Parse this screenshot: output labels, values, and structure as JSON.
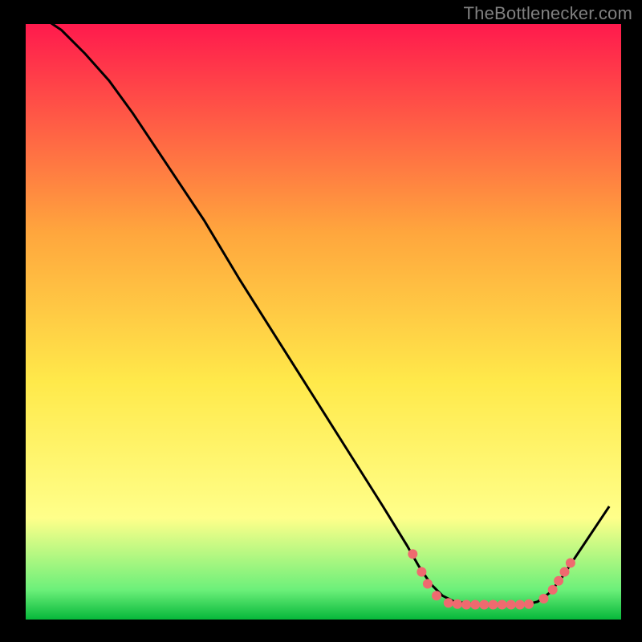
{
  "attribution": "TheBottlenecker.com",
  "colors": {
    "frame": "#000000",
    "watermark": "#808080",
    "grad_top": "#ff1a4d",
    "grad_mid_high": "#ffa63d",
    "grad_mid": "#ffe94a",
    "grad_low_yellow": "#ffff8a",
    "grad_low_green": "#6cf07a",
    "grad_bottom": "#06b83a",
    "line": "#000000",
    "dot": "#ef6a6f"
  },
  "chart_data": {
    "type": "line",
    "title": "",
    "xlabel": "",
    "ylabel": "",
    "xlim": [
      0,
      100
    ],
    "ylim": [
      0,
      100
    ],
    "curve": [
      {
        "x": 3.0,
        "y": 101.0
      },
      {
        "x": 6.0,
        "y": 99.0
      },
      {
        "x": 10.0,
        "y": 95.0
      },
      {
        "x": 14.0,
        "y": 90.5
      },
      {
        "x": 18.0,
        "y": 85.0
      },
      {
        "x": 24.0,
        "y": 76.0
      },
      {
        "x": 30.0,
        "y": 67.0
      },
      {
        "x": 36.0,
        "y": 57.0
      },
      {
        "x": 42.0,
        "y": 47.5
      },
      {
        "x": 48.0,
        "y": 38.0
      },
      {
        "x": 54.0,
        "y": 28.5
      },
      {
        "x": 60.0,
        "y": 19.0
      },
      {
        "x": 64.0,
        "y": 12.5
      },
      {
        "x": 66.0,
        "y": 9.0
      },
      {
        "x": 68.0,
        "y": 6.0
      },
      {
        "x": 70.0,
        "y": 4.0
      },
      {
        "x": 72.0,
        "y": 3.0
      },
      {
        "x": 76.0,
        "y": 2.5
      },
      {
        "x": 80.0,
        "y": 2.5
      },
      {
        "x": 84.0,
        "y": 2.5
      },
      {
        "x": 86.0,
        "y": 3.0
      },
      {
        "x": 88.0,
        "y": 4.5
      },
      {
        "x": 90.0,
        "y": 7.0
      },
      {
        "x": 92.0,
        "y": 10.0
      },
      {
        "x": 94.0,
        "y": 13.0
      },
      {
        "x": 96.0,
        "y": 16.0
      },
      {
        "x": 98.0,
        "y": 19.0
      }
    ],
    "dots": [
      {
        "x": 65.0,
        "y": 11.0
      },
      {
        "x": 66.5,
        "y": 8.0
      },
      {
        "x": 67.5,
        "y": 6.0
      },
      {
        "x": 69.0,
        "y": 4.0
      },
      {
        "x": 71.0,
        "y": 2.8
      },
      {
        "x": 72.5,
        "y": 2.6
      },
      {
        "x": 74.0,
        "y": 2.5
      },
      {
        "x": 75.5,
        "y": 2.5
      },
      {
        "x": 77.0,
        "y": 2.5
      },
      {
        "x": 78.5,
        "y": 2.5
      },
      {
        "x": 80.0,
        "y": 2.5
      },
      {
        "x": 81.5,
        "y": 2.5
      },
      {
        "x": 83.0,
        "y": 2.5
      },
      {
        "x": 84.5,
        "y": 2.6
      },
      {
        "x": 87.0,
        "y": 3.5
      },
      {
        "x": 88.5,
        "y": 5.0
      },
      {
        "x": 89.5,
        "y": 6.5
      },
      {
        "x": 90.5,
        "y": 8.0
      },
      {
        "x": 91.5,
        "y": 9.5
      }
    ]
  }
}
